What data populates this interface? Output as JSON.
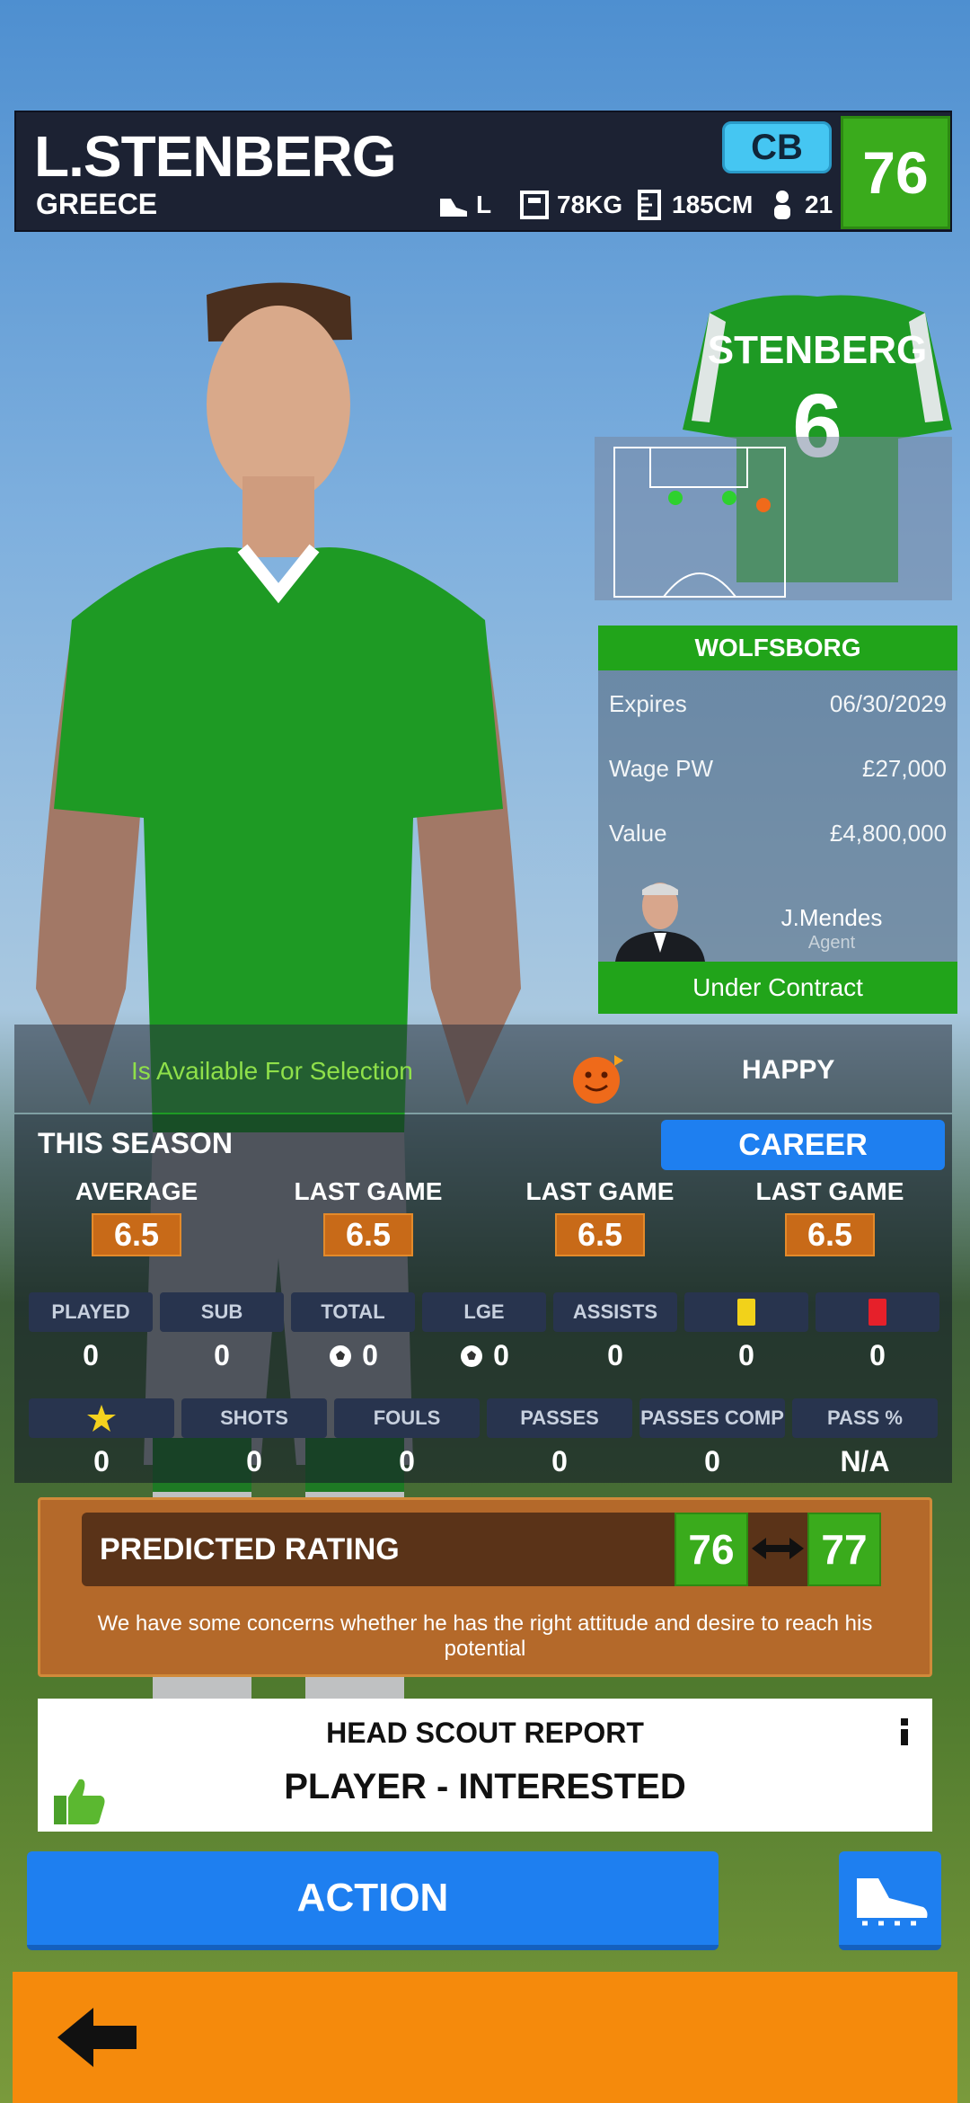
{
  "player": {
    "name": "L.STENBERG",
    "nation": "GREECE",
    "foot": "L",
    "weight": "78KG",
    "height": "185CM",
    "age": "21",
    "position": "CB",
    "overall": "76"
  },
  "kit": {
    "name": "STENBERG",
    "number": "6",
    "color": "#1e9a24"
  },
  "contract": {
    "club": "WOLFSBORG",
    "rows": [
      {
        "label": "Expires",
        "value": "06/30/2029"
      },
      {
        "label": "Wage PW",
        "value": "£27,000"
      },
      {
        "label": "Value",
        "value": "£4,800,000"
      }
    ],
    "agent_name": "J.Mendes",
    "agent_role": "Agent",
    "status": "Under Contract"
  },
  "availability": {
    "text": "Is Available For Selection",
    "mood": "HAPPY"
  },
  "season": {
    "title": "THIS SEASON",
    "career_button": "CAREER",
    "ratings": [
      {
        "label": "AVERAGE",
        "value": "6.5"
      },
      {
        "label": "LAST GAME",
        "value": "6.5"
      },
      {
        "label": "LAST GAME",
        "value": "6.5"
      },
      {
        "label": "LAST GAME",
        "value": "6.5"
      }
    ],
    "row1": [
      {
        "label": "PLAYED",
        "value": "0",
        "icon": ""
      },
      {
        "label": "SUB",
        "value": "0",
        "icon": ""
      },
      {
        "label": "TOTAL",
        "value": "0",
        "icon": "ball-icon"
      },
      {
        "label": "LGE",
        "value": "0",
        "icon": "ball-icon"
      },
      {
        "label": "ASSISTS",
        "value": "0",
        "icon": ""
      },
      {
        "label": "",
        "value": "0",
        "icon": "yellow-card-icon"
      },
      {
        "label": "",
        "value": "0",
        "icon": "red-card-icon"
      }
    ],
    "row2": [
      {
        "label": "",
        "value": "0",
        "icon": "star-icon"
      },
      {
        "label": "SHOTS",
        "value": "0"
      },
      {
        "label": "FOULS",
        "value": "0"
      },
      {
        "label": "PASSES",
        "value": "0"
      },
      {
        "label": "PASSES COMP",
        "value": "0"
      },
      {
        "label": "PASS %",
        "value": "N/A"
      }
    ]
  },
  "predicted": {
    "label": "PREDICTED RATING",
    "low": "76",
    "high": "77",
    "note": "We have some concerns whether he has the right attitude and desire to reach his potential"
  },
  "scout": {
    "title": "HEAD SCOUT REPORT",
    "result": "PLAYER - INTERESTED"
  },
  "action": {
    "label": "ACTION"
  },
  "colors": {
    "green": "#3aab1c",
    "blue": "#1e7ff0",
    "orange": "#f58a0c",
    "brown": "#b4692a"
  }
}
